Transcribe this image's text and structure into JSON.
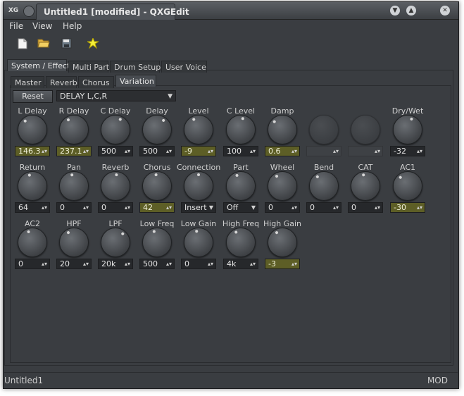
{
  "window": {
    "app_logo": "XG",
    "title": "Untitled1 [modified] - QXGEdit"
  },
  "menu": [
    "File",
    "View",
    "Help"
  ],
  "toolbar": [
    "new-file-icon",
    "open-folder-icon",
    "save-disk-icon",
    "star-burst-icon"
  ],
  "main_tabs": [
    "System / Effect",
    "Multi Part",
    "Drum Setup",
    "User Voice"
  ],
  "sub_tabs": [
    "Master",
    "Reverb",
    "Chorus",
    "Variation"
  ],
  "reset_label": "Reset",
  "effect_type": "DELAY L,C,R",
  "params": [
    {
      "label": "L Delay",
      "value": "146.3",
      "hl": true
    },
    {
      "label": "R Delay",
      "value": "237.1",
      "hl": true
    },
    {
      "label": "C Delay",
      "value": "500"
    },
    {
      "label": "Delay",
      "value": "500"
    },
    {
      "label": "Level",
      "value": "-9",
      "hl": true
    },
    {
      "label": "C Level",
      "value": "100"
    },
    {
      "label": "Damp",
      "value": "0.6",
      "hl": true
    },
    {
      "label": "",
      "value": "",
      "disabled": true
    },
    {
      "label": "",
      "value": "",
      "disabled": true
    },
    {
      "label": "Dry/Wet",
      "value": "-32"
    },
    {
      "label": "Return",
      "value": "64"
    },
    {
      "label": "Pan",
      "value": "0"
    },
    {
      "label": "Reverb",
      "value": "0"
    },
    {
      "label": "Chorus",
      "value": "42",
      "hl": true
    },
    {
      "label": "Connection",
      "value": "Insert",
      "dropdown": true
    },
    {
      "label": "Part",
      "value": "Off",
      "dropdown": true
    },
    {
      "label": "Wheel",
      "value": "0"
    },
    {
      "label": "Bend",
      "value": "0"
    },
    {
      "label": "CAT",
      "value": "0"
    },
    {
      "label": "AC1",
      "value": "-30",
      "hl": true
    },
    {
      "label": "AC2",
      "value": "0"
    },
    {
      "label": "HPF",
      "value": "20"
    },
    {
      "label": "LPF",
      "value": "20k"
    },
    {
      "label": "Low Freq",
      "value": "500"
    },
    {
      "label": "Low Gain",
      "value": "0"
    },
    {
      "label": "High Freq",
      "value": "4k"
    },
    {
      "label": "High Gain",
      "value": "-3",
      "hl": true
    }
  ],
  "status": {
    "left": "Untitled1",
    "right": "MOD"
  }
}
